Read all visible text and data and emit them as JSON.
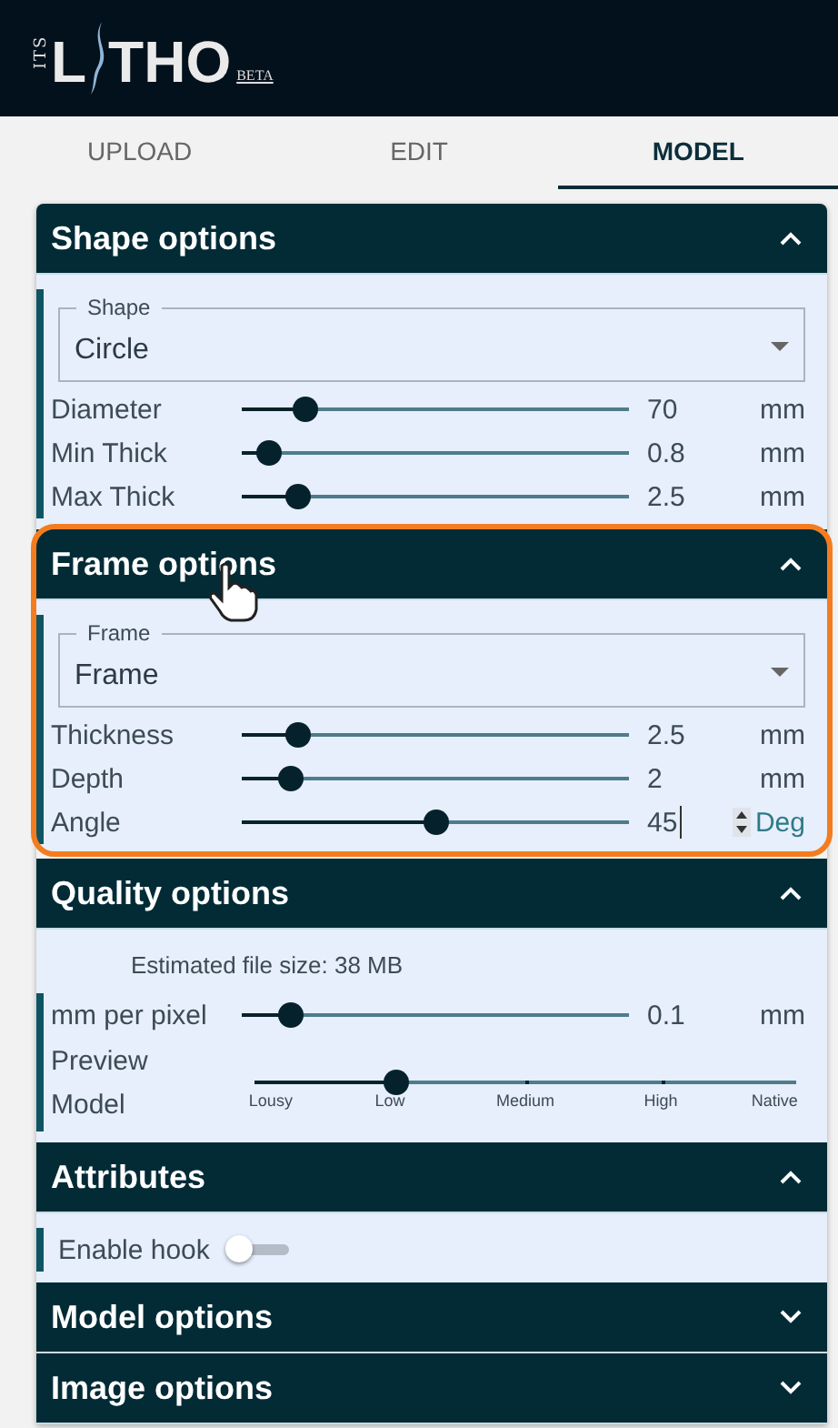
{
  "logo": {
    "side": "ITS",
    "first": "L",
    "rest": "THO",
    "badge": "BETA"
  },
  "tabs": [
    {
      "label": "UPLOAD",
      "selected": false
    },
    {
      "label": "EDIT",
      "selected": false
    },
    {
      "label": "MODEL",
      "selected": true
    }
  ],
  "sections": [
    {
      "title": "Shape options",
      "expanded": true,
      "highlighted": false,
      "items": [
        {
          "kind": "select",
          "label": "Shape",
          "value": "Circle"
        },
        {
          "kind": "slider",
          "label": "Diameter",
          "level": 0.14,
          "value": "70",
          "unit": "mm",
          "focused": false
        },
        {
          "kind": "slider",
          "label": "Min Thick",
          "level": 0.04,
          "value": "0.8",
          "unit": "mm",
          "focused": false
        },
        {
          "kind": "slider",
          "label": "Max Thick",
          "level": 0.12,
          "value": "2.5",
          "unit": "mm",
          "focused": false
        }
      ]
    },
    {
      "title": "Frame options",
      "expanded": true,
      "highlighted": true,
      "items": [
        {
          "kind": "select",
          "label": "Frame",
          "value": "Frame"
        },
        {
          "kind": "slider",
          "label": "Thickness",
          "level": 0.12,
          "value": "2.5",
          "unit": "mm",
          "focused": false
        },
        {
          "kind": "slider",
          "label": "Depth",
          "level": 0.1,
          "value": "2",
          "unit": "mm",
          "focused": false
        },
        {
          "kind": "slider",
          "label": "Angle",
          "level": 0.5,
          "value": "45",
          "unit": "Deg",
          "focused": true
        }
      ]
    },
    {
      "title": "Quality options",
      "expanded": true,
      "highlighted": false,
      "items": [
        {
          "kind": "note",
          "text": "Estimated file size: 38 MB"
        },
        {
          "kind": "slider",
          "label": "mm per pixel",
          "level": 0.1,
          "value": "0.1",
          "unit": "mm",
          "focused": false
        },
        {
          "kind": "steps",
          "label": "Preview Model",
          "level": 0.25,
          "steps": [
            "Lousy",
            "Low",
            "Medium",
            "High",
            "Native"
          ]
        }
      ]
    },
    {
      "title": "Attributes",
      "expanded": true,
      "highlighted": false,
      "items": [
        {
          "kind": "switch",
          "label": "Enable hook",
          "on": false
        }
      ]
    },
    {
      "title": "Model options",
      "expanded": false,
      "highlighted": false
    },
    {
      "title": "Image options",
      "expanded": false,
      "highlighted": false
    }
  ]
}
